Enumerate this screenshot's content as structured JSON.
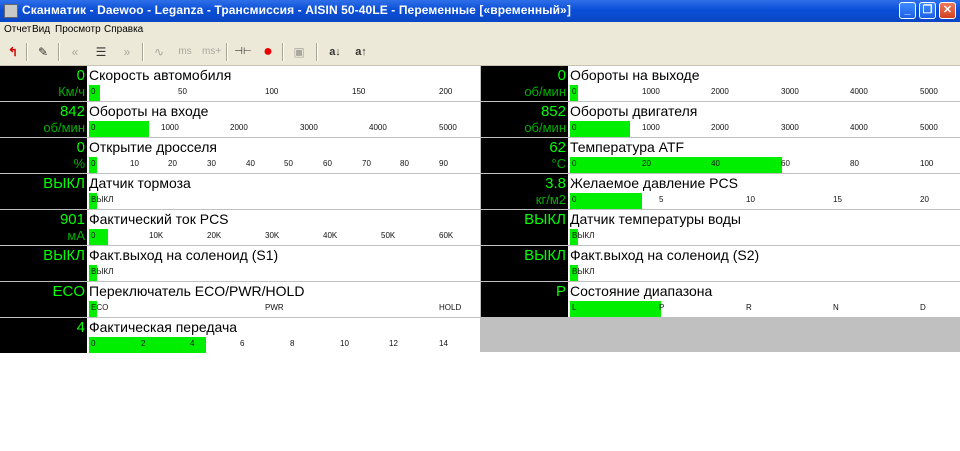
{
  "window": {
    "title": "Сканматик - Daewoo - Leganza - Трансмиссия - AISIN 50-40LE - Переменные [«временный»]",
    "min_glyph": "_",
    "max_glyph": "❐",
    "close_glyph": "✕"
  },
  "menu": [
    "Отчет",
    "Вид",
    "Просмотр",
    "Справка"
  ],
  "toolbar": {
    "back_glyph": "↰",
    "edit_glyph": "✎",
    "prev_glyph": "«",
    "list_glyph": "☰",
    "next_glyph": "»",
    "wave_glyph": "∿",
    "ms_label": "ms",
    "ms_plus_label": "ms+",
    "connect_glyph": "⊣⊢",
    "record_glyph": "●",
    "image_glyph": "▣",
    "sort_down_label": "a↓",
    "sort_up_label": "a↑"
  },
  "params": [
    {
      "value": "0",
      "unit": "Км/ч",
      "name": "Скорость автомобиля",
      "ticks": [
        "0",
        "50",
        "100",
        "150",
        "200"
      ],
      "fill": 0.03
    },
    {
      "value": "0",
      "unit": "об/мин",
      "name": "Обороты на выходе",
      "ticks": [
        "0",
        "1000",
        "2000",
        "3000",
        "4000",
        "5000"
      ],
      "fill": 0.02
    },
    {
      "value": "842",
      "unit": "об/мин",
      "name": "Обороты на входе",
      "ticks": [
        "0",
        "1000",
        "2000",
        "3000",
        "4000",
        "5000"
      ],
      "fill": 0.16
    },
    {
      "value": "852",
      "unit": "об/мин",
      "name": "Обороты двигателя",
      "ticks": [
        "0",
        "1000",
        "2000",
        "3000",
        "4000",
        "5000"
      ],
      "fill": 0.16
    },
    {
      "value": "0",
      "unit": "%",
      "name": "Открытие дросселя",
      "ticks": [
        "0",
        "10",
        "20",
        "30",
        "40",
        "50",
        "60",
        "70",
        "80",
        "90"
      ],
      "fill": 0.02
    },
    {
      "value": "62",
      "unit": "°C",
      "name": "Температура ATF",
      "ticks": [
        "0",
        "20",
        "40",
        "60",
        "80",
        "100"
      ],
      "fill": 0.56
    },
    {
      "value": "ВЫКЛ",
      "unit": "",
      "name": "Датчик тормоза",
      "ticks": [
        "ВЫКЛ"
      ],
      "fill": 0.02
    },
    {
      "value": "3.8",
      "unit": "кг/м2",
      "name": "Желаемое давление PCS",
      "ticks": [
        "0",
        "5",
        "10",
        "15",
        "20"
      ],
      "fill": 0.19
    },
    {
      "value": "901",
      "unit": "мА",
      "name": "Фактический ток PCS",
      "ticks": [
        "0",
        "10K",
        "20K",
        "30K",
        "40K",
        "50K",
        "60K"
      ],
      "fill": 0.05
    },
    {
      "value": "ВЫКЛ",
      "unit": "",
      "name": "Датчик температуры воды",
      "ticks": [
        "ВЫКЛ"
      ],
      "fill": 0.02
    },
    {
      "value": "ВЫКЛ",
      "unit": "",
      "name": "Факт.выход на соленоид (S1)",
      "ticks": [
        "ВЫКЛ"
      ],
      "fill": 0.02
    },
    {
      "value": "ВЫКЛ",
      "unit": "",
      "name": "Факт.выход на соленоид (S2)",
      "ticks": [
        "ВЫКЛ"
      ],
      "fill": 0.02
    },
    {
      "value": "ECO",
      "unit": "",
      "name": "Переключатель ECO/PWR/HOLD",
      "ticks": [
        "ECO",
        "PWR",
        "HOLD"
      ],
      "fill": 0.02
    },
    {
      "value": "P",
      "unit": "",
      "name": "Состояние диапазона",
      "ticks": [
        "L",
        "P",
        "R",
        "N",
        "D"
      ],
      "fill": 0.24
    },
    {
      "value": "4",
      "unit": "",
      "name": "Фактическая передача",
      "ticks": [
        "0",
        "2",
        "4",
        "6",
        "8",
        "10",
        "12",
        "14"
      ],
      "fill": 0.31
    }
  ],
  "colors": {
    "value_green": "#00ff00",
    "bar_green": "#00ee00",
    "value_bg": "#000000",
    "grid_gray": "#c0c0c0"
  }
}
